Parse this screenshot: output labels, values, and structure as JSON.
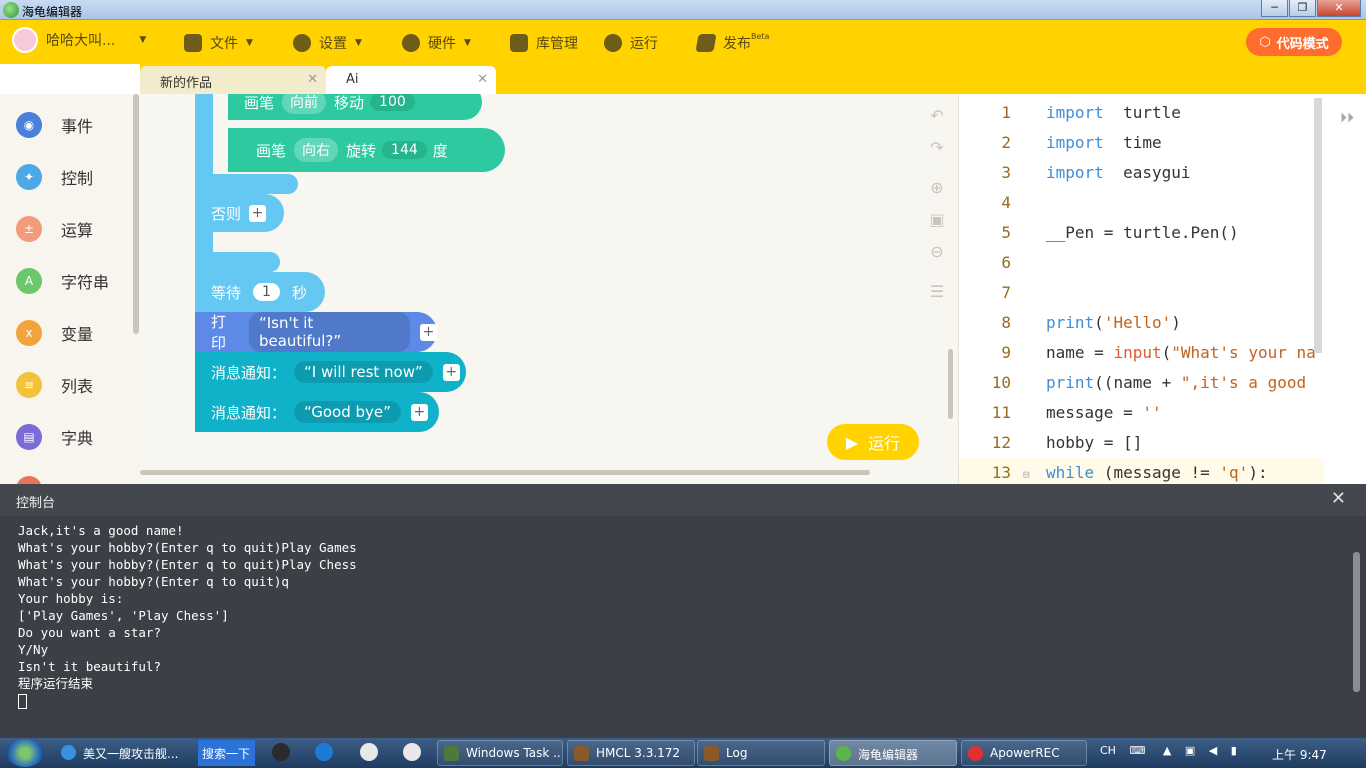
{
  "window": {
    "title": "海龟编辑器"
  },
  "toolbar": {
    "user": "哈哈大叫...",
    "file": "文件",
    "settings": "设置",
    "hardware": "硬件",
    "library": "库管理",
    "run": "运行",
    "publish": "发布",
    "publish_badge": "Beta",
    "code_mode": "代码模式"
  },
  "tabs": [
    {
      "label": "新的作品"
    },
    {
      "label": "Ai"
    }
  ],
  "categories": [
    {
      "label": "事件",
      "color": "#4a7fdc"
    },
    {
      "label": "控制",
      "color": "#4aa9e6"
    },
    {
      "label": "运算",
      "color": "#f29b7d"
    },
    {
      "label": "字符串",
      "color": "#6cc76a"
    },
    {
      "label": "变量",
      "color": "#f2a33a"
    },
    {
      "label": "列表",
      "color": "#f2c33a"
    },
    {
      "label": "字典",
      "color": "#7b6bd6"
    }
  ],
  "blocks": {
    "pen1": {
      "label": "画笔",
      "dir": "向前",
      "action": "移动",
      "value": "100"
    },
    "pen2": {
      "label": "画笔",
      "dir": "向右",
      "action": "旋转",
      "value": "144",
      "unit": "度"
    },
    "else": "否则",
    "wait": {
      "label": "等待",
      "value": "1",
      "unit": "秒"
    },
    "print": {
      "label": "打印",
      "text": "“Isn't it beautiful?”"
    },
    "notify1": {
      "label": "消息通知：",
      "text": "“I will rest now”"
    },
    "notify2": {
      "label": "消息通知：",
      "text": "“Good bye”"
    },
    "run_button": "运行"
  },
  "code_lines": [
    {
      "n": "1",
      "parts": [
        [
          "kw",
          "import"
        ],
        [
          "",
          "  turtle"
        ]
      ]
    },
    {
      "n": "2",
      "parts": [
        [
          "kw",
          "import"
        ],
        [
          "",
          "  time"
        ]
      ]
    },
    {
      "n": "3",
      "parts": [
        [
          "kw",
          "import"
        ],
        [
          "",
          "  easygui"
        ]
      ]
    },
    {
      "n": "4",
      "parts": []
    },
    {
      "n": "5",
      "parts": [
        [
          "",
          "__Pen = turtle.Pen()"
        ]
      ]
    },
    {
      "n": "6",
      "parts": []
    },
    {
      "n": "7",
      "parts": []
    },
    {
      "n": "8",
      "parts": [
        [
          "kw",
          "print"
        ],
        [
          "",
          "("
        ],
        [
          "str",
          "'Hello'"
        ],
        [
          "",
          ")"
        ]
      ]
    },
    {
      "n": "9",
      "parts": [
        [
          "",
          "name = "
        ],
        [
          "fn",
          "input"
        ],
        [
          "",
          "("
        ],
        [
          "str",
          "\"What's your na"
        ]
      ]
    },
    {
      "n": "10",
      "parts": [
        [
          "kw",
          "print"
        ],
        [
          "",
          "((name + "
        ],
        [
          "str",
          "\",it's a good"
        ]
      ]
    },
    {
      "n": "11",
      "parts": [
        [
          "",
          "message = "
        ],
        [
          "str",
          "''"
        ]
      ]
    },
    {
      "n": "12",
      "parts": [
        [
          "",
          "hobby = []"
        ]
      ]
    },
    {
      "n": "13",
      "parts": [
        [
          "kw",
          "while"
        ],
        [
          "",
          " (message != "
        ],
        [
          "str",
          "'q'"
        ],
        [
          "",
          "):"
        ]
      ]
    }
  ],
  "console": {
    "title": "控制台",
    "lines": [
      "Jack,it's a good name!",
      "What's your hobby?(Enter q to quit)Play Games",
      "What's your hobby?(Enter q to quit)Play Chess",
      "What's your hobby?(Enter q to quit)q",
      "Your hobby is:",
      "['Play Games', 'Play Chess']",
      "Do you want a star?",
      "Y/Ny",
      "Isn't it beautiful?",
      "程序运行结束"
    ]
  },
  "taskbar": {
    "ie_label": "美又一艘攻击舰...",
    "search": "搜索一下",
    "items": [
      "Windows Task ...",
      "HMCL 3.3.172",
      "Log",
      "海龟编辑器",
      "ApowerREC"
    ],
    "lang": "CH",
    "time": "上午 9:47"
  }
}
